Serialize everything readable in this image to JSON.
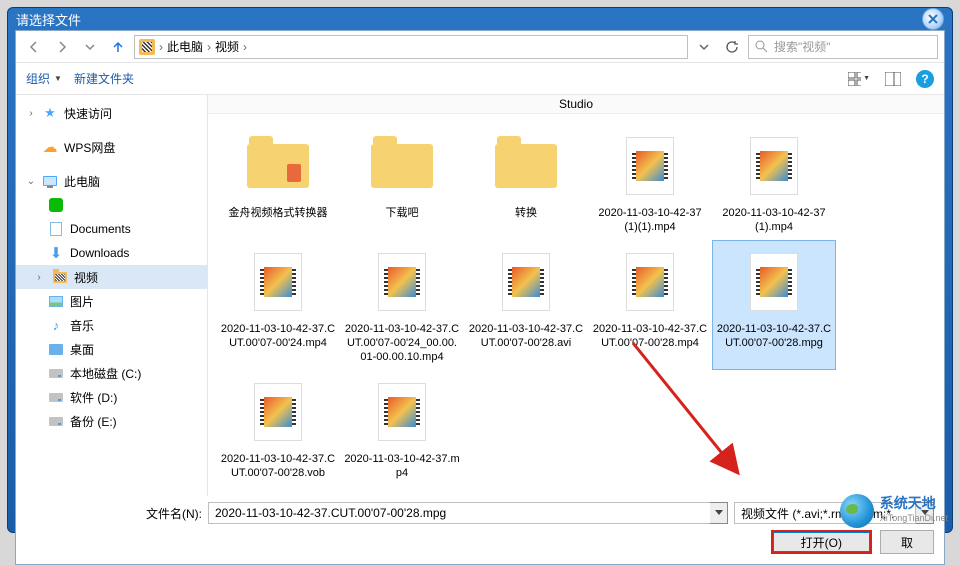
{
  "title": "请选择文件",
  "breadcrumb": {
    "loc1": "此电脑",
    "loc2": "视频"
  },
  "search_placeholder": "搜索\"视频\"",
  "toolbar": {
    "organize": "组织",
    "newfolder": "新建文件夹"
  },
  "sidebar": {
    "quick": "快速访问",
    "wps": "WPS网盘",
    "thispc": "此电脑",
    "wechat": "",
    "documents": "Documents",
    "downloads": "Downloads",
    "videos": "视频",
    "pictures": "图片",
    "music": "音乐",
    "desktop": "桌面",
    "drivec": "本地磁盘 (C:)",
    "drived": "软件 (D:)",
    "drivee": "备份 (E:)"
  },
  "studio": "Studio",
  "items": [
    {
      "type": "folder",
      "name": "金舟视频格式转换器",
      "badge": true
    },
    {
      "type": "folder",
      "name": "下载吧"
    },
    {
      "type": "folder",
      "name": "转换"
    },
    {
      "type": "video",
      "name": "2020-11-03-10-42-37(1)(1).mp4"
    },
    {
      "type": "video",
      "name": "2020-11-03-10-42-37(1).mp4"
    },
    {
      "type": "video",
      "name": "2020-11-03-10-42-37.CUT.00'07-00'24.mp4"
    },
    {
      "type": "video",
      "name": "2020-11-03-10-42-37.CUT.00'07-00'24_00.00.01-00.00.10.mp4"
    },
    {
      "type": "video",
      "name": "2020-11-03-10-42-37.CUT.00'07-00'28.avi"
    },
    {
      "type": "video",
      "name": "2020-11-03-10-42-37.CUT.00'07-00'28.mp4"
    },
    {
      "type": "video",
      "name": "2020-11-03-10-42-37.CUT.00'07-00'28.mpg",
      "selected": true
    },
    {
      "type": "video",
      "name": "2020-11-03-10-42-37.CUT.00'07-00'28.vob"
    },
    {
      "type": "video",
      "name": "2020-11-03-10-42-37.mp4"
    }
  ],
  "footer": {
    "filename_label": "文件名(N):",
    "filename_value": "2020-11-03-10-42-37.CUT.00'07-00'28.mpg",
    "filter": "视频文件 (*.avi;*.rmvb;*.rm;*.",
    "open": "打开(O)",
    "cancel": "取"
  },
  "watermark": {
    "line1": "系统天地",
    "line2": "XiTongTianDi.net"
  }
}
